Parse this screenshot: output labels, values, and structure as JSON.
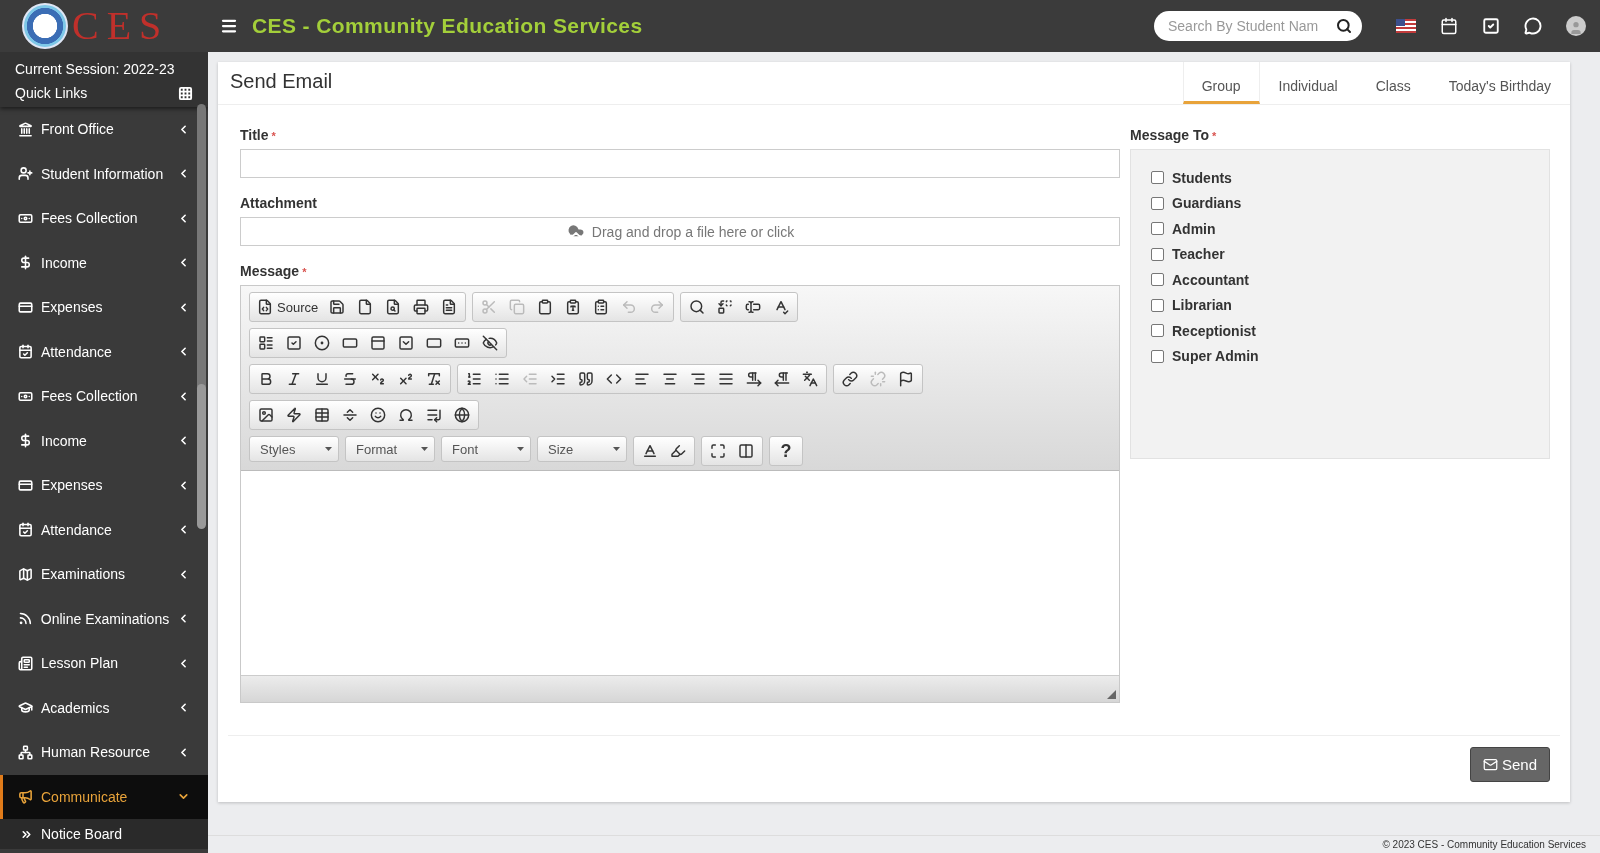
{
  "header": {
    "logo_text": "CES",
    "title": "CES - Community Education Services",
    "search": {
      "placeholder": "Search By Student Nam"
    }
  },
  "sidebar": {
    "session": "Current Session: 2022-23",
    "quick_links": "Quick Links",
    "items": [
      {
        "kind": "front-office",
        "label": "Front Office",
        "selected": false,
        "expanded": false
      },
      {
        "kind": "student",
        "label": "Student Information",
        "selected": false,
        "expanded": false
      },
      {
        "kind": "fees",
        "label": "Fees Collection",
        "selected": false,
        "expanded": false
      },
      {
        "kind": "income",
        "label": "Income",
        "selected": false,
        "expanded": false
      },
      {
        "kind": "expenses",
        "label": "Expenses",
        "selected": false,
        "expanded": false
      },
      {
        "kind": "attendance",
        "label": "Attendance",
        "selected": false,
        "expanded": false
      },
      {
        "kind": "fees",
        "label": "Fees Collection",
        "selected": false,
        "expanded": false
      },
      {
        "kind": "income",
        "label": "Income",
        "selected": false,
        "expanded": false
      },
      {
        "kind": "expenses",
        "label": "Expenses",
        "selected": false,
        "expanded": false
      },
      {
        "kind": "attendance",
        "label": "Attendance",
        "selected": false,
        "expanded": false
      },
      {
        "kind": "exams",
        "label": "Examinations",
        "selected": false,
        "expanded": false
      },
      {
        "kind": "online",
        "label": "Online Examinations",
        "selected": false,
        "expanded": false
      },
      {
        "kind": "lesson",
        "label": "Lesson Plan",
        "selected": false,
        "expanded": false
      },
      {
        "kind": "academics",
        "label": "Academics",
        "selected": false,
        "expanded": false
      },
      {
        "kind": "hr",
        "label": "Human Resource",
        "selected": false,
        "expanded": false
      },
      {
        "kind": "communicate",
        "label": "Communicate",
        "selected": true,
        "expanded": true,
        "children": [
          {
            "label": "Notice Board"
          }
        ]
      }
    ]
  },
  "page": {
    "title": "Send Email",
    "tabs": [
      {
        "label": "Group",
        "selected": true
      },
      {
        "label": "Individual",
        "selected": false
      },
      {
        "label": "Class",
        "selected": false
      },
      {
        "label": "Today's Birthday",
        "selected": false
      }
    ],
    "title_field": {
      "label": "Title",
      "required_mark": "*"
    },
    "attachment": {
      "label": "Attachment",
      "dropzone": "Drag and drop a file here or click"
    },
    "message": {
      "label": "Message",
      "required_mark": "*"
    },
    "editor_toolbar": [
      [
        [
          {
            "kind": "source",
            "text": "Source"
          },
          {
            "kind": "save"
          },
          {
            "kind": "new"
          },
          {
            "kind": "preview"
          },
          {
            "kind": "print"
          },
          {
            "kind": "templates"
          }
        ],
        [
          {
            "kind": "cut",
            "disabled": true
          },
          {
            "kind": "copy",
            "disabled": true
          },
          {
            "kind": "paste"
          },
          {
            "kind": "paste-text"
          },
          {
            "kind": "paste-word"
          },
          {
            "kind": "undo",
            "disabled": true
          },
          {
            "kind": "redo",
            "disabled": true
          }
        ],
        [
          {
            "kind": "find"
          },
          {
            "kind": "replace"
          },
          {
            "kind": "select-all"
          },
          {
            "kind": "spell"
          }
        ]
      ],
      [
        [
          {
            "kind": "form"
          },
          {
            "kind": "checkbox"
          },
          {
            "kind": "radio"
          },
          {
            "kind": "textfield"
          },
          {
            "kind": "textarea"
          },
          {
            "kind": "select"
          },
          {
            "kind": "button"
          },
          {
            "kind": "image-button"
          },
          {
            "kind": "hidden"
          }
        ]
      ],
      [
        [
          {
            "kind": "bold"
          },
          {
            "kind": "italic"
          },
          {
            "kind": "underline"
          },
          {
            "kind": "strike"
          },
          {
            "kind": "subscript"
          },
          {
            "kind": "superscript"
          },
          {
            "kind": "remove-format"
          }
        ],
        [
          {
            "kind": "ordered-list"
          },
          {
            "kind": "bullet-list"
          },
          {
            "kind": "outdent",
            "disabled": true
          },
          {
            "kind": "indent"
          },
          {
            "kind": "quote"
          },
          {
            "kind": "div"
          },
          {
            "kind": "align-left"
          },
          {
            "kind": "align-center"
          },
          {
            "kind": "align-right"
          },
          {
            "kind": "justify"
          },
          {
            "kind": "ltr"
          },
          {
            "kind": "rtl"
          },
          {
            "kind": "language"
          }
        ],
        [
          {
            "kind": "link"
          },
          {
            "kind": "unlink",
            "disabled": true
          },
          {
            "kind": "anchor"
          }
        ]
      ],
      [
        [
          {
            "kind": "image"
          },
          {
            "kind": "flash"
          },
          {
            "kind": "table"
          },
          {
            "kind": "hr"
          },
          {
            "kind": "smiley"
          },
          {
            "kind": "special-char"
          },
          {
            "kind": "page-break"
          },
          {
            "kind": "iframe"
          }
        ]
      ],
      [
        [
          {
            "kind": "combo",
            "text": "Styles"
          }
        ],
        [
          {
            "kind": "combo",
            "text": "Format"
          }
        ],
        [
          {
            "kind": "combo",
            "text": "Font"
          }
        ],
        [
          {
            "kind": "combo",
            "text": "Size"
          }
        ],
        [
          {
            "kind": "text-color"
          },
          {
            "kind": "bg-color"
          }
        ],
        [
          {
            "kind": "maximize"
          },
          {
            "kind": "show-blocks"
          }
        ],
        [
          {
            "kind": "help",
            "text": "?"
          }
        ]
      ]
    ],
    "message_to": {
      "label": "Message To",
      "required_mark": "*",
      "options": [
        {
          "label": "Students",
          "checked": false
        },
        {
          "label": "Guardians",
          "checked": false
        },
        {
          "label": "Admin",
          "checked": false
        },
        {
          "label": "Teacher",
          "checked": false
        },
        {
          "label": "Accountant",
          "checked": false
        },
        {
          "label": "Librarian",
          "checked": false
        },
        {
          "label": "Receptionist",
          "checked": false
        },
        {
          "label": "Super Admin",
          "checked": false
        }
      ]
    },
    "send_button": "Send"
  },
  "footer": "© 2023 CES - Community Education Services"
}
